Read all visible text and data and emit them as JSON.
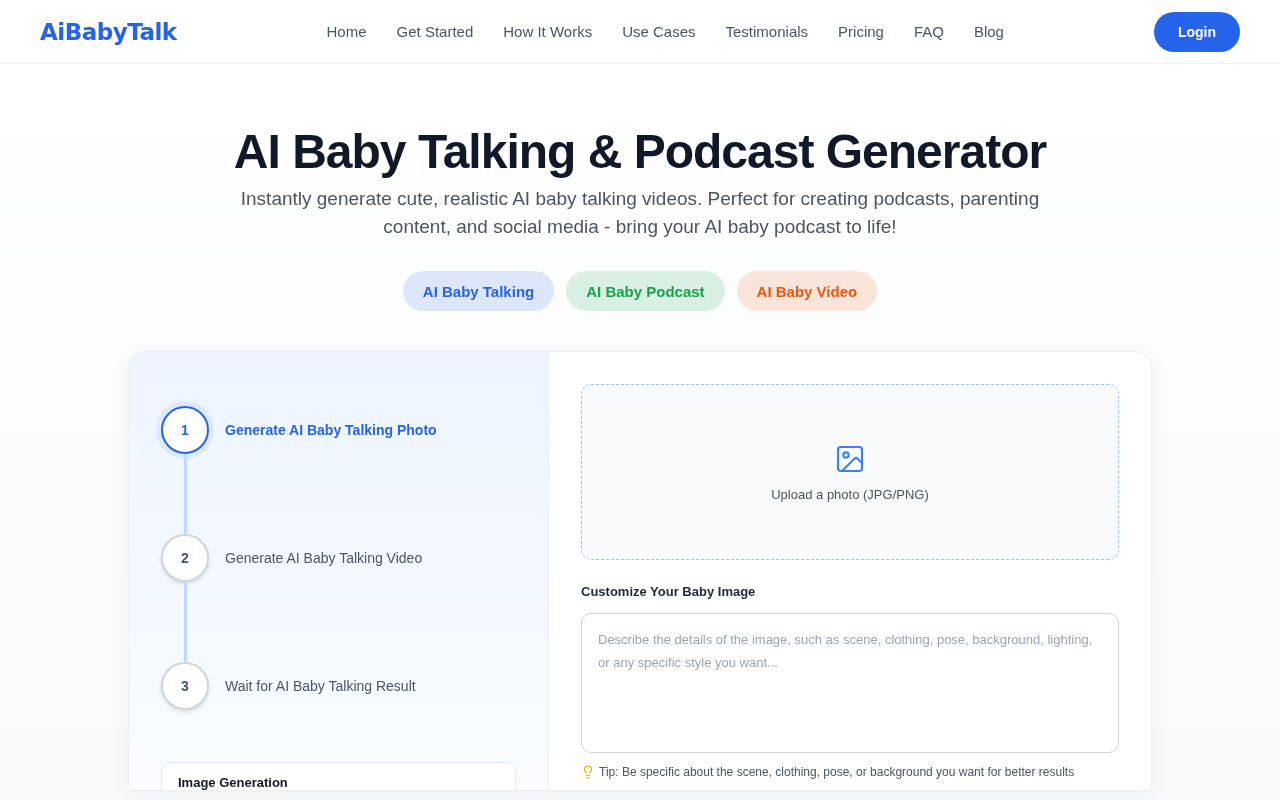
{
  "header": {
    "logo": "AiBabyTalk",
    "nav": [
      "Home",
      "Get Started",
      "How It Works",
      "Use Cases",
      "Testimonials",
      "Pricing",
      "FAQ",
      "Blog"
    ],
    "login": "Login"
  },
  "hero": {
    "title": "AI Baby Talking & Podcast Generator",
    "subtitle": "Instantly generate cute, realistic AI baby talking videos. Perfect for creating podcasts, parenting content, and social media - bring your AI baby podcast to life!",
    "tags": [
      {
        "label": "AI Baby Talking",
        "color": "#2563eb"
      },
      {
        "label": "AI Baby Podcast",
        "color": "#16a34a"
      },
      {
        "label": "AI Baby Video",
        "color": "#ea580c"
      }
    ]
  },
  "steps": [
    {
      "number": "1",
      "label": "Generate AI Baby Talking Photo",
      "selected": true
    },
    {
      "number": "2",
      "label": "Generate AI Baby Talking Video",
      "selected": false
    },
    {
      "number": "3",
      "label": "Wait for AI Baby Talking Result",
      "selected": false
    }
  ],
  "status_card": {
    "title": "Image Generation"
  },
  "upload": {
    "label": "Upload a photo (JPG/PNG)"
  },
  "customize": {
    "label": "Customize Your Baby Image",
    "placeholder": "Describe the details of the image, such as scene, clothing, pose, background, lighting, or any specific style you want...",
    "tip": "Tip: Be specific about the scene, clothing, pose, or background you want for better results"
  }
}
